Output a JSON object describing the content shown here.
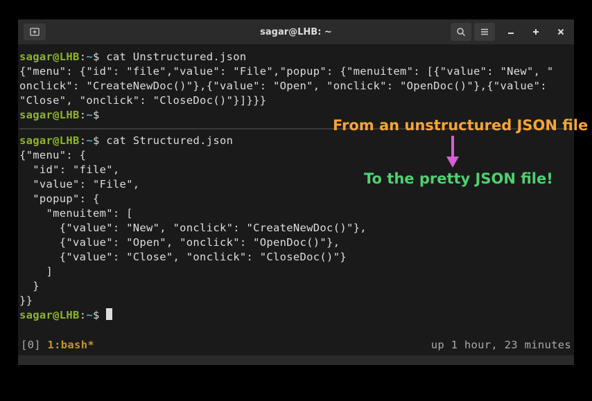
{
  "titlebar": {
    "title": "sagar@LHB: ~"
  },
  "prompt": {
    "user": "sagar@LHB",
    "sep": ":",
    "path": "~",
    "symbol": "$"
  },
  "block1": {
    "command": " cat Unstructured.json",
    "output": "{\"menu\": {\"id\": \"file\",\"value\": \"File\",\"popup\": {\"menuitem\": [{\"value\": \"New\", \"\nonclick\": \"CreateNewDoc()\"},{\"value\": \"Open\", \"onclick\": \"OpenDoc()\"},{\"value\":\n\"Close\", \"onclick\": \"CloseDoc()\"}]}}}"
  },
  "block2": {
    "command": " cat Structured.json",
    "output": "{\"menu\": {\n  \"id\": \"file\",\n  \"value\": \"File\",\n  \"popup\": {\n    \"menuitem\": [\n      {\"value\": \"New\", \"onclick\": \"CreateNewDoc()\"},\n      {\"value\": \"Open\", \"onclick\": \"OpenDoc()\"},\n      {\"value\": \"Close\", \"onclick\": \"CloseDoc()\"}\n    ]\n  }\n}}"
  },
  "annotations": {
    "top": "From an unstructured JSON file",
    "bottom": "To the pretty JSON file!"
  },
  "statusbar": {
    "left_prefix": "[0] ",
    "active": "1:bash*",
    "right": "up 1 hour, 23 minutes"
  }
}
